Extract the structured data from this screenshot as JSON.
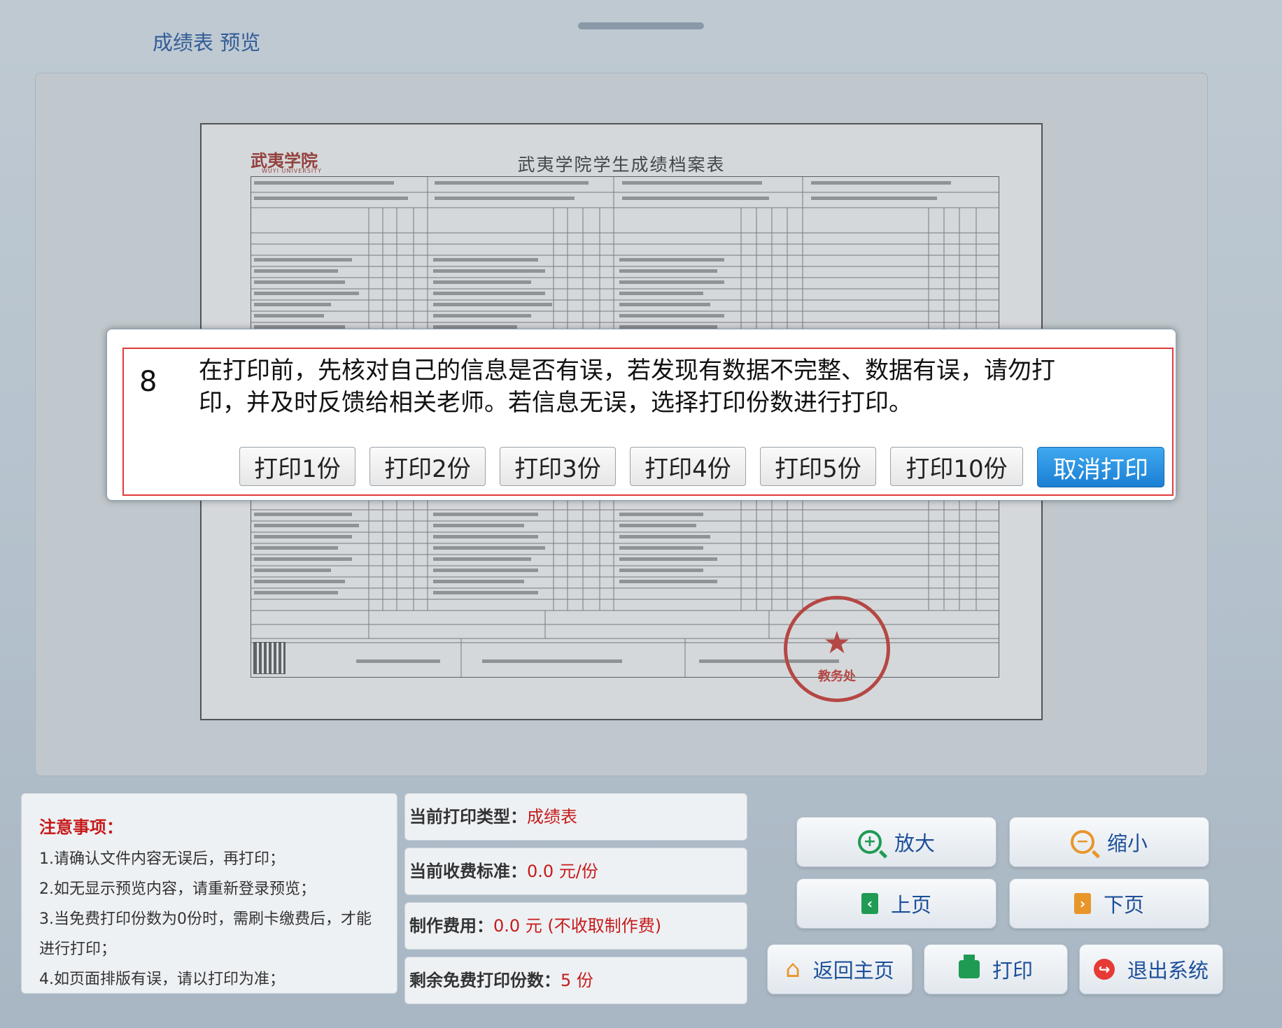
{
  "header": {
    "title": "成绩表 预览"
  },
  "document": {
    "school_logo": "武夷学院",
    "school_logo_en": "WUYI UNIVERSITY",
    "title": "武夷学院学生成绩档案表",
    "seal_text": "教务处"
  },
  "notice": {
    "title": "注意事项：",
    "items": [
      "1.请确认文件内容无误后，再打印；",
      "2.如无显示预览内容，请重新登录预览；",
      "3.当免费打印份数为0份时，需刷卡缴费后，才能",
      "进行打印；",
      "4.如页面排版有误，请以打印为准；"
    ]
  },
  "info": {
    "print_type_label": "当前打印类型：",
    "print_type_value": "成绩表",
    "fee_label": "当前收费标准：",
    "fee_value": "0.0 元/份",
    "make_fee_label": "制作费用：",
    "make_fee_value": "0.0 元 (不收取制作费)",
    "free_copies_label": "剩余免费打印份数：",
    "free_copies_value": "5 份"
  },
  "controls": {
    "zoom_in": "放大",
    "zoom_out": "缩小",
    "prev_page": "上页",
    "next_page": "下页",
    "home": "返回主页",
    "print": "打印",
    "exit": "退出系统"
  },
  "dialog": {
    "step_number": "8",
    "message": "在打印前，先核对自己的信息是否有误，若发现有数据不完整、数据有误，请勿打印，并及时反馈给相关老师。若信息无误，选择打印份数进行打印。",
    "copy_buttons": [
      "打印1份",
      "打印2份",
      "打印3份",
      "打印4份",
      "打印5份",
      "打印10份"
    ],
    "cancel": "取消打印"
  },
  "colors": {
    "accent_blue": "#1d4f9a",
    "warning_red": "#c61a1a",
    "dialog_border": "#e23a3a",
    "cancel_button": "#1b7fd3"
  },
  "icons": {
    "zoom_in": "zoom-in-icon",
    "zoom_out": "zoom-out-icon",
    "prev": "prev-page-icon",
    "next": "next-page-icon",
    "home": "house-icon",
    "print": "printer-icon",
    "exit": "exit-icon"
  }
}
